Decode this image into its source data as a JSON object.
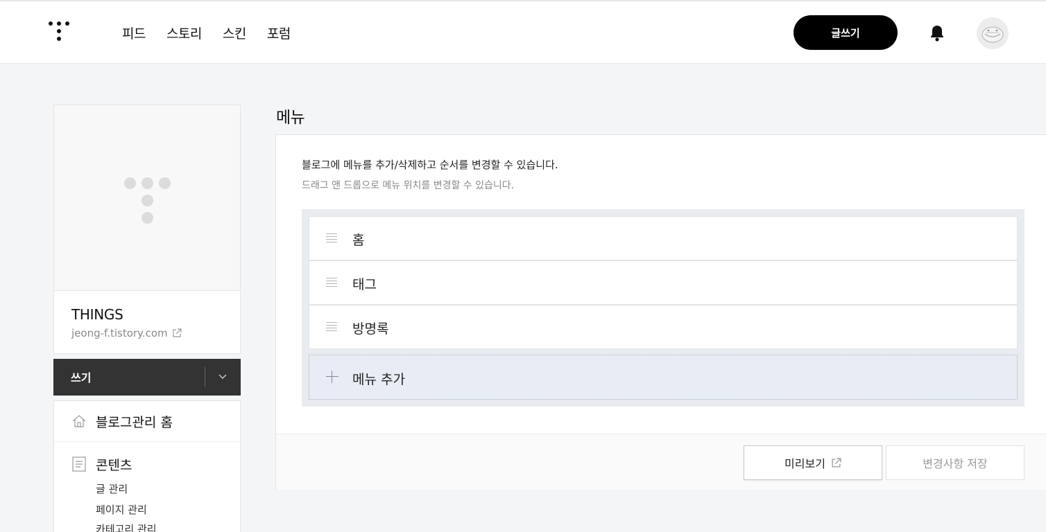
{
  "header": {
    "nav": [
      "피드",
      "스토리",
      "스킨",
      "포럼"
    ],
    "write_button": "글쓰기"
  },
  "sidebar": {
    "blog_name": "THINGS",
    "blog_url": "jeong-f.tistory.com",
    "write_label": "쓰기",
    "menu_home": "블로그관리 홈",
    "menu_content": "콘텐츠",
    "content_items": [
      "글 관리",
      "페이지 관리",
      "카테고리 관리"
    ]
  },
  "main": {
    "title": "메뉴",
    "description": "블로그에 메뉴를 추가/삭제하고 순서를 변경할 수 있습니다.",
    "hint": "드래그 앤 드롭으로 메뉴 위치를 변경할 수 있습니다.",
    "menu_items": [
      "홈",
      "태그",
      "방명록"
    ],
    "add_menu": "메뉴 추가",
    "preview_button": "미리보기",
    "save_button": "변경사항 저장"
  },
  "colors": {
    "accent": "#000000",
    "sidebar_write_bar": "#333333",
    "list_background": "#e8ebf0"
  }
}
